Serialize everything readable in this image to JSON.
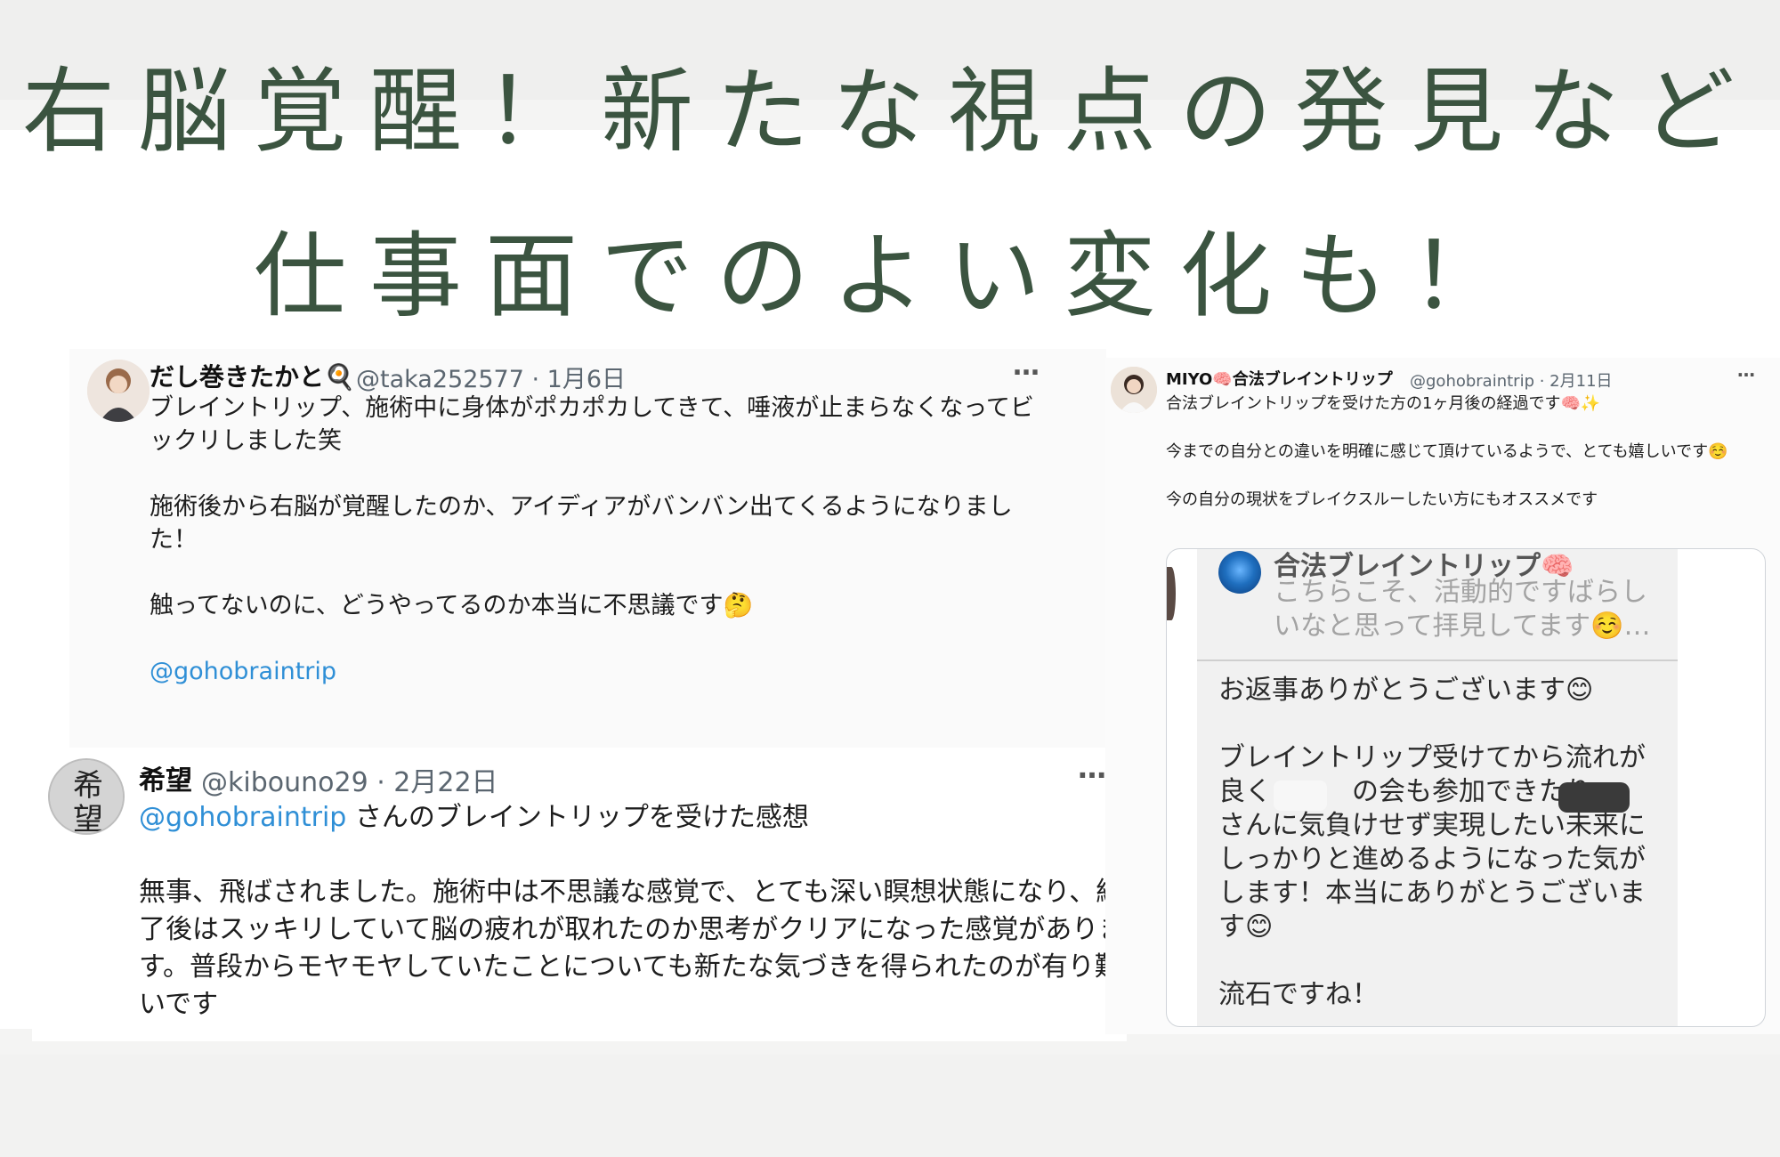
{
  "headline": {
    "line1": "右脳覚醒！新たな視点の発見など",
    "line2": "仕事面でのよい変化も！"
  },
  "colors": {
    "headline": "#3b5440",
    "mention": "#2f8fd6"
  },
  "posts": [
    {
      "author": "だし巻きたかと🍳",
      "handle": "@taka252577 · 1月6日",
      "more": "…",
      "body": "ブレイントリップ、施術中に身体がポカポカしてきて、唾液が止まらなくなってビックリしました笑\n\n施術後から右脳が覚醒したのか、アイディアがバンバン出てくるようになりました！\n\n触ってないのに、どうやってるのか本当に不思議です🤔",
      "mention": "@gohobraintrip"
    },
    {
      "author": "希望",
      "handle": "@kibouno29 · 2月22日",
      "more": "…",
      "mention": "@gohobraintrip",
      "mention_suffix": " さんのブレイントリップを受けた感想",
      "body": "無事、飛ばされました。施術中は不思議な感覚で、とても深い瞑想状態になり、終了後はスッキリしていて脳の疲れが取れたのか思考がクリアになった感覚があります。普段からモヤモヤしていたことについても新たな気づきを得られたのが有り難いです",
      "avatar_text": "希望"
    },
    {
      "author": "MIYO🧠合法ブレイントリップ",
      "handle": "@gohobraintrip · 2月11日",
      "more": "…",
      "body": "合法ブレイントリップを受けた方の1ヶ月後の経過です🧠✨\n\n今までの自分との違いを明確に感じて頂けているようで、とても嬉しいです☺️\n\n今の自分の現状をブレイクスルーしたい方にもオススメです",
      "embed": {
        "name": "合法ブレイントリップ🧠",
        "quote": "こちらこそ、活動的ですばらしいなと思って拝見してます☺️…",
        "reply": "お返事ありがとうございます😊\n\nブレイントリップ受けてから流れが良く　　　の会も参加できたり　　さんに気負けせず実現したい未来にしっかりと進めるようになった気がします！本当にありがとうございます😊\n\n流石ですね！"
      }
    }
  ]
}
